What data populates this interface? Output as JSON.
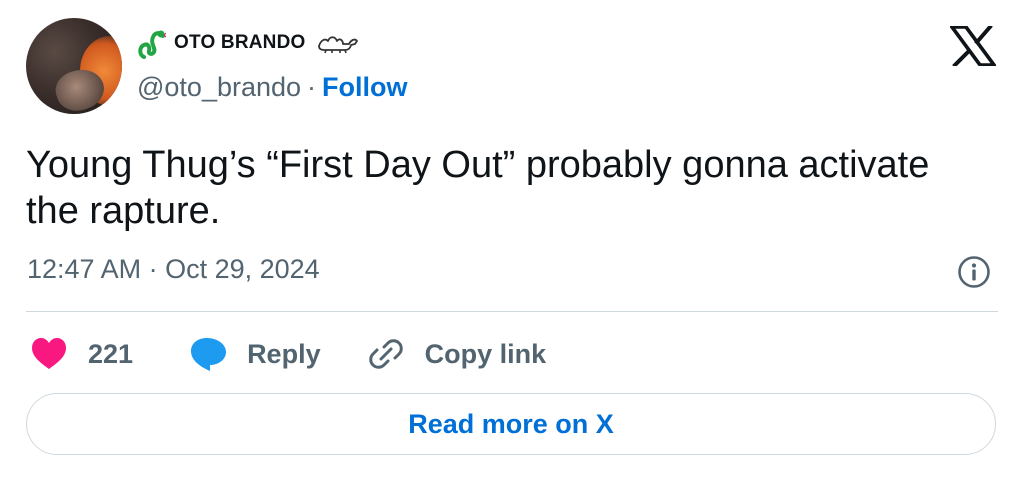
{
  "author": {
    "display_name": "OTO BRANDO",
    "handle": "@oto_brando",
    "separator": "·",
    "follow_label": "Follow"
  },
  "tweet": {
    "text": "Young Thug’s “First Day Out” probably gonna activate the rapture.",
    "timestamp": "12:47 AM · Oct 29, 2024"
  },
  "actions": {
    "likes_count": "221",
    "reply_label": "Reply",
    "copy_link_label": "Copy link"
  },
  "read_more_label": "Read more on X",
  "icons": {
    "avatar": "avatar-photo",
    "name_emoji_1": "snake-icon",
    "name_emoji_2": "camel-icon",
    "logo": "x-logo-icon",
    "info": "info-icon",
    "like": "heart-icon",
    "reply": "reply-bubble-icon",
    "copy_link": "link-icon"
  },
  "colors": {
    "like": "#f91880",
    "reply": "#1d9bf0",
    "link_blue": "#006fd6",
    "secondary_text": "#536471",
    "border": "#cfd9de",
    "snake": "#22a545"
  }
}
